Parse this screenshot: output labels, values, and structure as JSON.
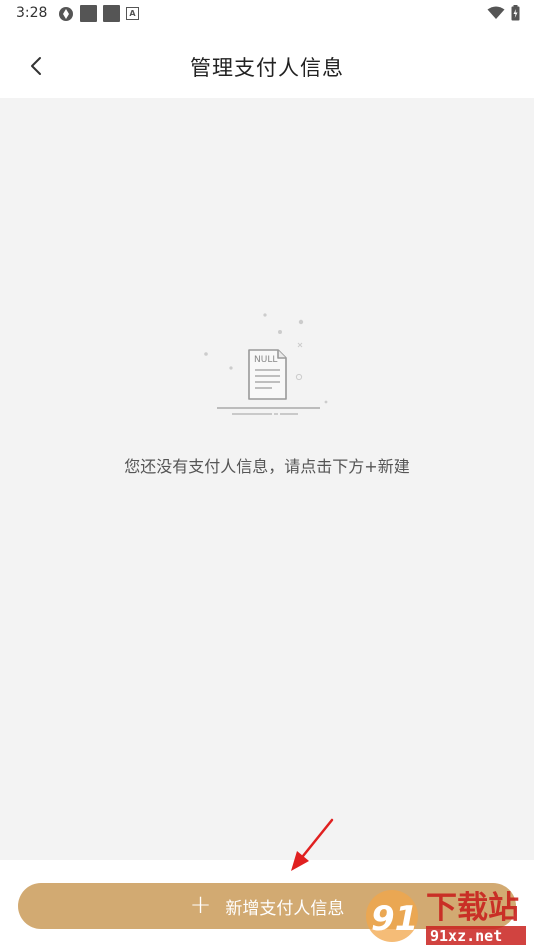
{
  "status_bar": {
    "time": "3:28"
  },
  "nav": {
    "title": "管理支付人信息"
  },
  "empty_state": {
    "message": "您还没有支付人信息，请点击下方+新建",
    "doc_label": "NULL"
  },
  "actions": {
    "add_label": "新增支付人信息",
    "plus_symbol": "+"
  },
  "watermark": {
    "text_large": "下载站",
    "text_small": "91xz.net",
    "logo_num": "91"
  },
  "colors": {
    "accent": "#d2aa72",
    "background": "#f3f3f3",
    "annotation_arrow": "#e02020"
  }
}
